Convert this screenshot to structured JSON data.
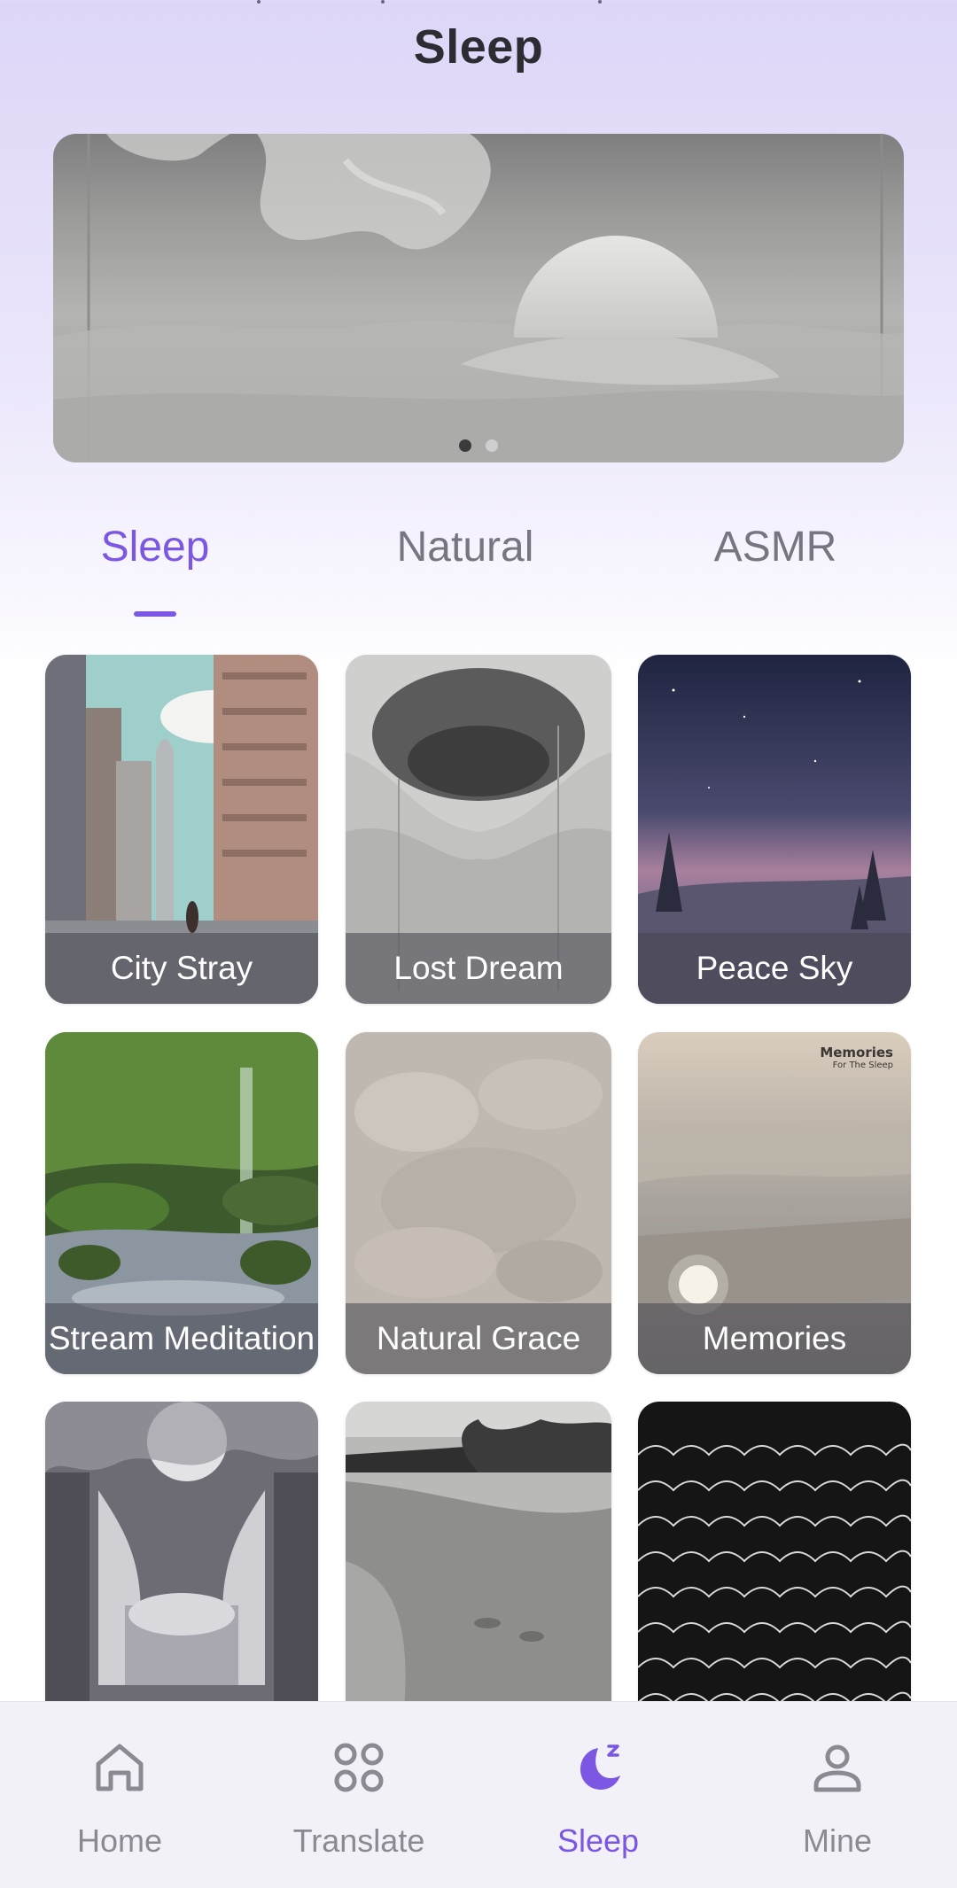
{
  "header": {
    "title": "Sleep"
  },
  "banner": {
    "slide_count": 2,
    "active_slide": 1
  },
  "tabs": [
    {
      "label": "Sleep",
      "active": true
    },
    {
      "label": "Natural",
      "active": false
    },
    {
      "label": "ASMR",
      "active": false
    }
  ],
  "cards": [
    {
      "label": "City Stray"
    },
    {
      "label": "Lost Dream"
    },
    {
      "label": "Peace Sky"
    },
    {
      "label": "Stream Meditation"
    },
    {
      "label": "Natural Grace"
    },
    {
      "label": "Memories",
      "art_text": [
        "Memories",
        "For The Sleep"
      ]
    },
    {
      "label": ""
    },
    {
      "label": ""
    },
    {
      "label": ""
    }
  ],
  "bottom_nav": [
    {
      "label": "Home",
      "icon": "home-icon",
      "active": false
    },
    {
      "label": "Translate",
      "icon": "grid-icon",
      "active": false
    },
    {
      "label": "Sleep",
      "icon": "moon-icon",
      "active": true
    },
    {
      "label": "Mine",
      "icon": "person-icon",
      "active": false
    }
  ],
  "colors": {
    "accent": "#7b57e4",
    "inactive_text": "#777680",
    "header_gradient_top": "#ddd6f7"
  }
}
